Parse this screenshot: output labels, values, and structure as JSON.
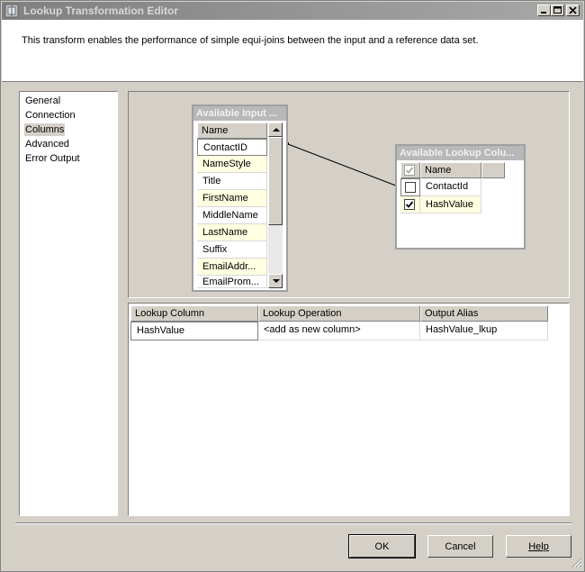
{
  "window": {
    "title": "Lookup Transformation Editor"
  },
  "description": "This transform enables the performance of simple equi-joins between the input and a reference data set.",
  "nav": [
    {
      "label": "General",
      "selected": false
    },
    {
      "label": "Connection",
      "selected": false
    },
    {
      "label": "Columns",
      "selected": true
    },
    {
      "label": "Advanced",
      "selected": false
    },
    {
      "label": "Error Output",
      "selected": false
    }
  ],
  "input_box": {
    "title": "Available Input ...",
    "header": "Name",
    "rows": [
      "ContactID",
      "NameStyle",
      "Title",
      "FirstName",
      "MiddleName",
      "LastName",
      "Suffix",
      "EmailAddr...",
      "EmailProm..."
    ]
  },
  "lookup_box": {
    "title": "Available Lookup Colu...",
    "header": "Name",
    "rows": [
      {
        "name": "ContactId",
        "checked": false
      },
      {
        "name": "HashValue",
        "checked": true
      }
    ]
  },
  "grid": {
    "headers": [
      "Lookup Column",
      "Lookup Operation",
      "Output Alias"
    ],
    "rows": [
      {
        "lookup_column": "HashValue",
        "operation": "<add as new column>",
        "alias": "HashValue_lkup"
      }
    ]
  },
  "buttons": {
    "ok": "OK",
    "cancel": "Cancel",
    "help": "Help"
  }
}
